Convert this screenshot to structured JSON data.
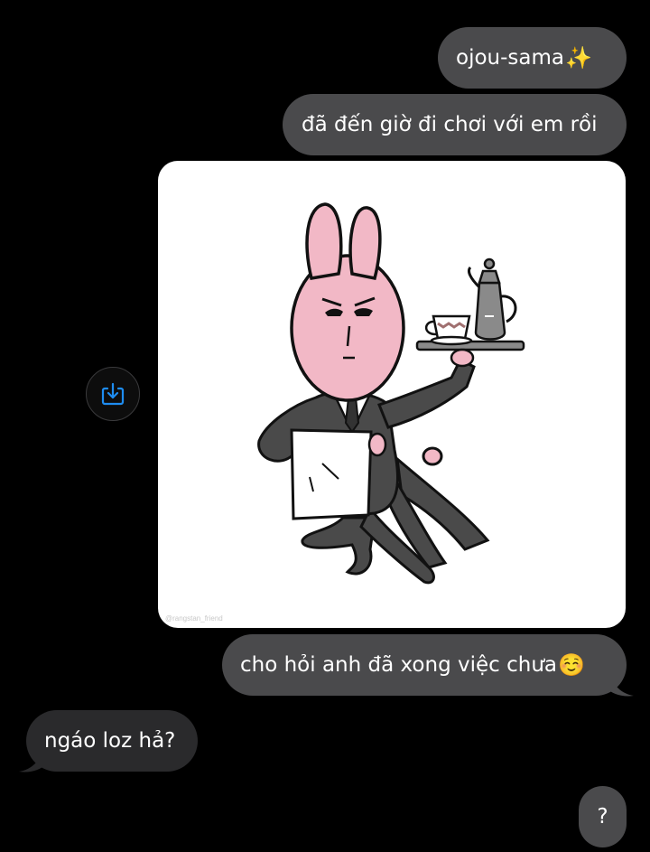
{
  "messages": {
    "m1": {
      "text": "ojou-sama",
      "emoji": "✨"
    },
    "m2": {
      "text": "đã đến giờ đi chơi với em rồi"
    },
    "m3": {
      "text": "cho hỏi anh đã xong việc chưa",
      "emoji": "☺️"
    },
    "m4": {
      "text": "ngáo loz hả?"
    },
    "m5": {
      "text": "?"
    }
  },
  "image": {
    "watermark": "@rangstan_friend",
    "alt": "cartoon pink rabbit butler with tea tray"
  },
  "icons": {
    "save": "save-image-icon"
  },
  "colors": {
    "background": "#000000",
    "sent_bubble": "#4a4a4c",
    "received_bubble": "#2a2a2c",
    "accent": "#1e8cf0"
  }
}
